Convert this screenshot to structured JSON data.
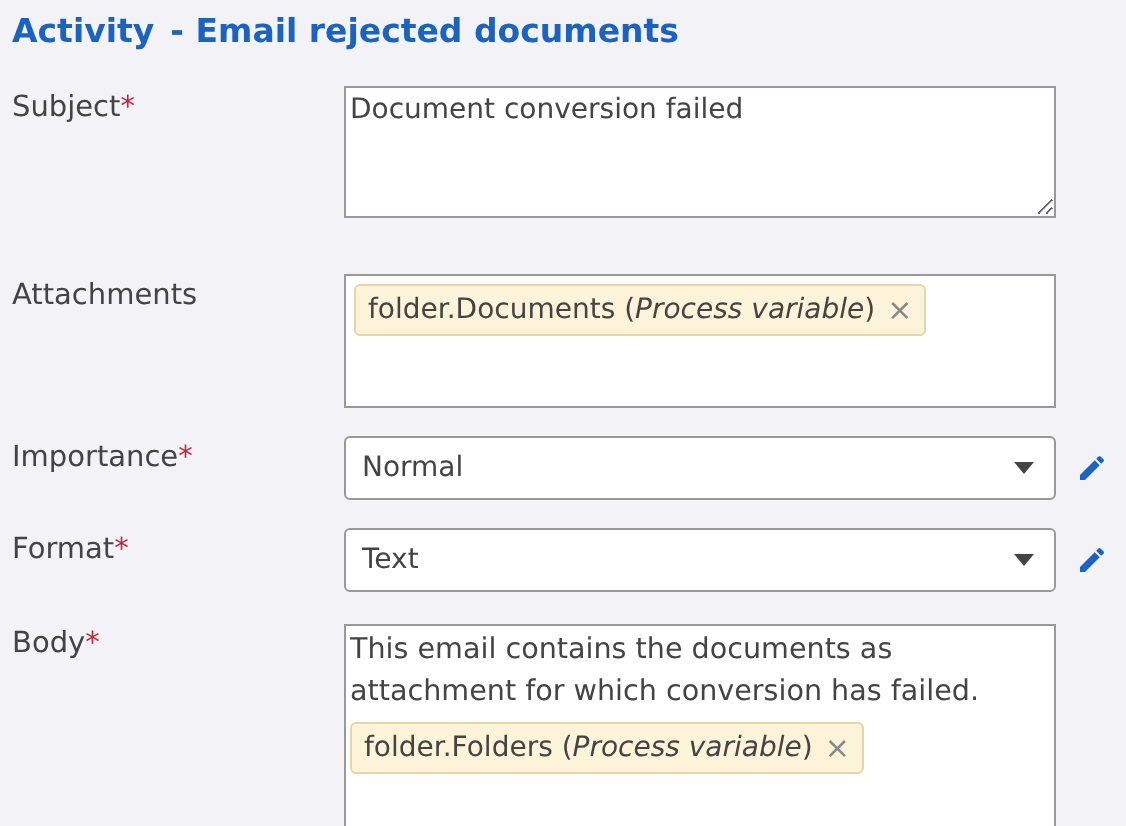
{
  "title": {
    "main": "Activity",
    "sub": "- Email rejected documents"
  },
  "fields": [
    {
      "kind": "textarea",
      "label": "Subject",
      "required_mark": "*",
      "value": "Document conversion failed"
    },
    {
      "kind": "tags",
      "label": "Attachments",
      "tags": [
        {
          "text": "folder.Documents (*Process variable*)",
          "remove": "×"
        }
      ]
    },
    {
      "kind": "select",
      "label": "Importance",
      "required_mark": "*",
      "value": "Normal"
    },
    {
      "kind": "select",
      "label": "Format",
      "required_mark": "*",
      "value": "Text"
    },
    {
      "kind": "body",
      "label": "Body",
      "required_mark": "*",
      "value": "This email contains the documents as attachment for which conversion has failed.",
      "tags": [
        {
          "text": "folder.Folders (*Process variable*)",
          "remove": "×"
        }
      ]
    }
  ]
}
